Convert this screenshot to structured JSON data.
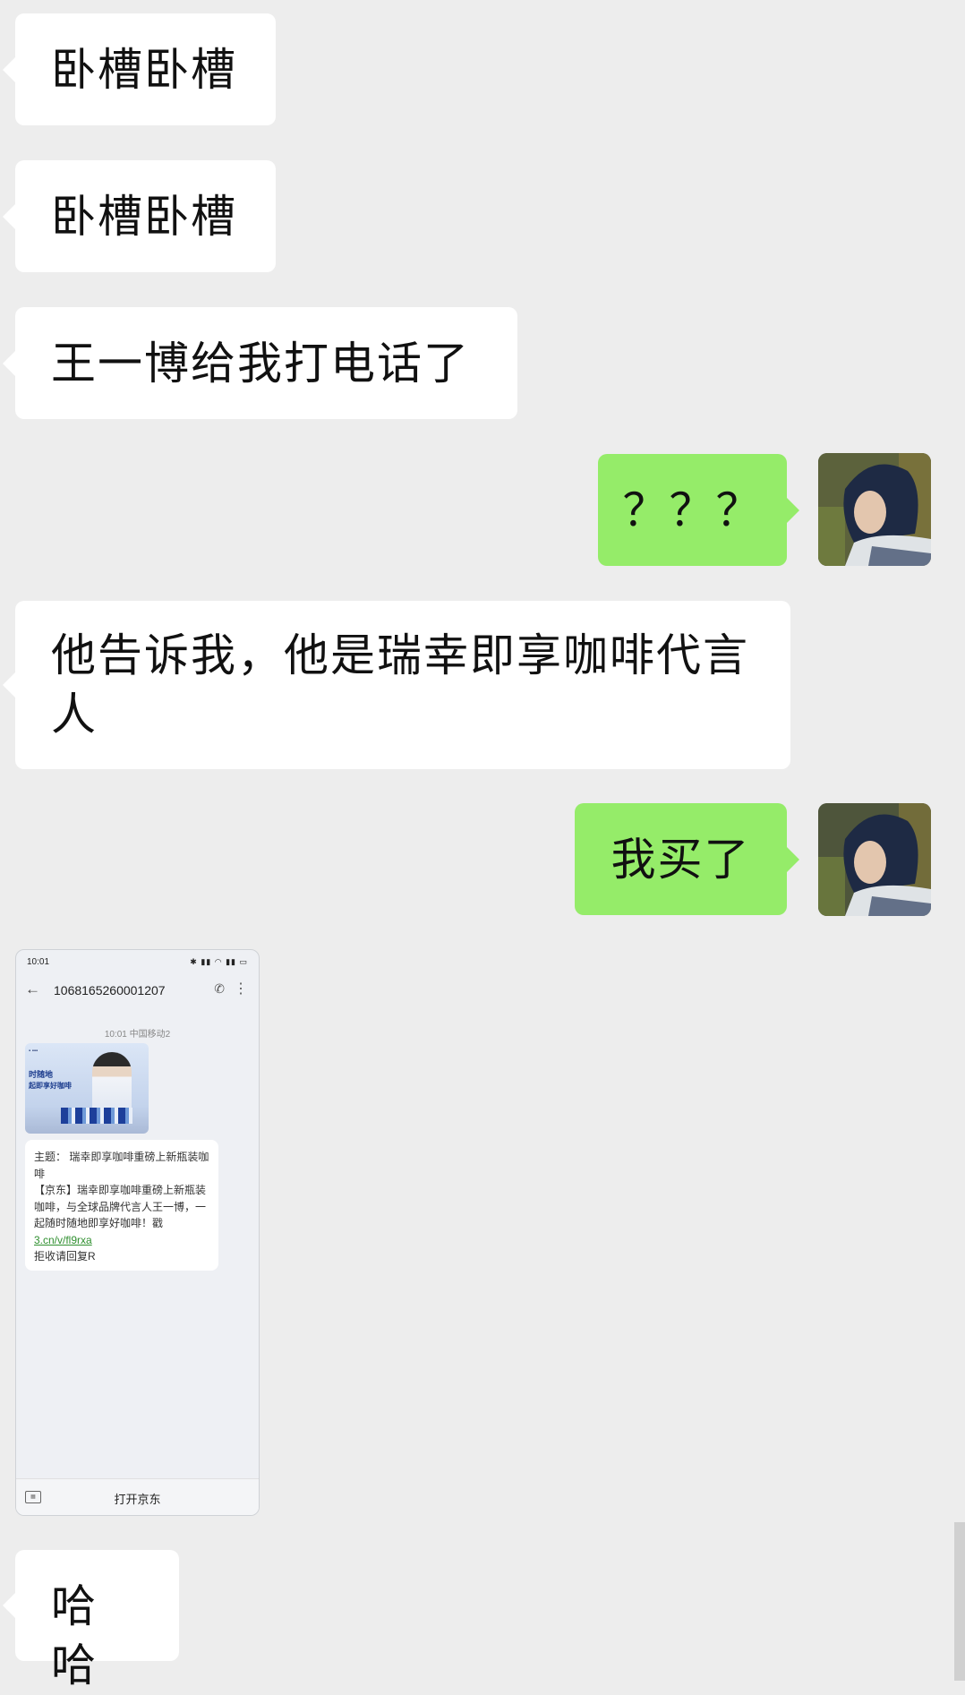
{
  "messages": [
    {
      "id": "m1",
      "side": "in",
      "text": "卧槽卧槽"
    },
    {
      "id": "m2",
      "side": "in",
      "text": "卧槽卧槽"
    },
    {
      "id": "m3",
      "side": "in",
      "text": "王一博给我打电话了"
    },
    {
      "id": "m4",
      "side": "out",
      "text": "？？？"
    },
    {
      "id": "m5",
      "side": "in",
      "text": "他告诉我，他是瑞幸即享咖啡代言人"
    },
    {
      "id": "m6",
      "side": "out",
      "text": "我买了"
    },
    {
      "id": "m8",
      "side": "in",
      "text": "哈哈"
    }
  ],
  "screenshot": {
    "status_time": "10:01",
    "sender_number": "1068165260001207",
    "received_time": "10:01 中国移动2",
    "promo_line1": "时随地",
    "promo_line2": "起即享好咖啡",
    "sms_text": "主题： 瑞幸即享咖啡重磅上新瓶装咖啡\n【京东】瑞幸即享咖啡重磅上新瓶装咖啡，与全球品牌代言人王一博，一起随时随地即享好咖啡！戳 ",
    "sms_link": "3.cn/v/fl9rxa",
    "sms_footer": "拒收请回复R",
    "open_button": "打开京东"
  },
  "colors": {
    "background": "#ededed",
    "incoming_bubble": "#ffffff",
    "outgoing_bubble": "#95ec69"
  },
  "icons": [
    "back-arrow-icon",
    "phone-icon",
    "more-icon",
    "keyboard-icon"
  ]
}
